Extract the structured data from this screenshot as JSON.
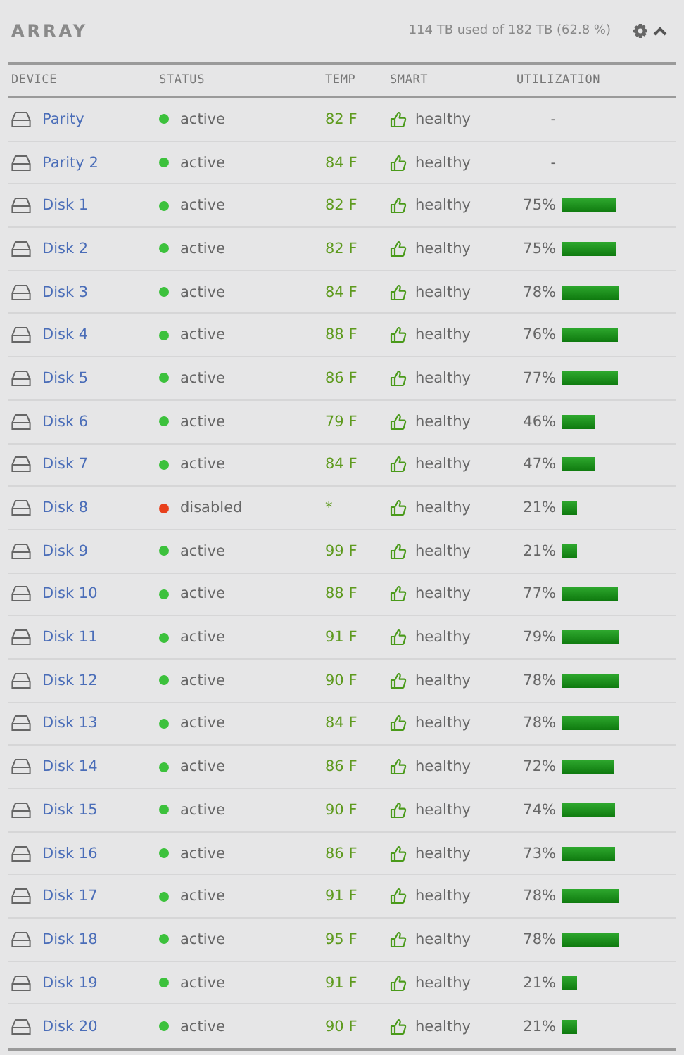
{
  "panel": {
    "title": "ARRAY",
    "usage": "114 TB used of 182 TB (62.8 %)"
  },
  "columns": [
    "DEVICE",
    "STATUS",
    "TEMP",
    "SMART",
    "UTILIZATION"
  ],
  "rows": [
    {
      "device": "Parity",
      "status": "active",
      "color": "#3cc13c",
      "temp": "82 F",
      "smart": "healthy",
      "utilization": "-"
    },
    {
      "device": "Parity 2",
      "status": "active",
      "color": "#3cc13c",
      "temp": "84 F",
      "smart": "healthy",
      "utilization": "-"
    },
    {
      "device": "Disk 1",
      "status": "active",
      "color": "#3cc13c",
      "temp": "82 F",
      "smart": "healthy",
      "utilization": "75%"
    },
    {
      "device": "Disk 2",
      "status": "active",
      "color": "#3cc13c",
      "temp": "82 F",
      "smart": "healthy",
      "utilization": "75%"
    },
    {
      "device": "Disk 3",
      "status": "active",
      "color": "#3cc13c",
      "temp": "84 F",
      "smart": "healthy",
      "utilization": "78%"
    },
    {
      "device": "Disk 4",
      "status": "active",
      "color": "#3cc13c",
      "temp": "88 F",
      "smart": "healthy",
      "utilization": "76%"
    },
    {
      "device": "Disk 5",
      "status": "active",
      "color": "#3cc13c",
      "temp": "86 F",
      "smart": "healthy",
      "utilization": "77%"
    },
    {
      "device": "Disk 6",
      "status": "active",
      "color": "#3cc13c",
      "temp": "79 F",
      "smart": "healthy",
      "utilization": "46%"
    },
    {
      "device": "Disk 7",
      "status": "active",
      "color": "#3cc13c",
      "temp": "84 F",
      "smart": "healthy",
      "utilization": "47%"
    },
    {
      "device": "Disk 8",
      "status": "disabled",
      "color": "#e8401c",
      "temp": "*",
      "smart": "healthy",
      "utilization": "21%"
    },
    {
      "device": "Disk 9",
      "status": "active",
      "color": "#3cc13c",
      "temp": "99 F",
      "smart": "healthy",
      "utilization": "21%"
    },
    {
      "device": "Disk 10",
      "status": "active",
      "color": "#3cc13c",
      "temp": "88 F",
      "smart": "healthy",
      "utilization": "77%"
    },
    {
      "device": "Disk 11",
      "status": "active",
      "color": "#3cc13c",
      "temp": "91 F",
      "smart": "healthy",
      "utilization": "79%"
    },
    {
      "device": "Disk 12",
      "status": "active",
      "color": "#3cc13c",
      "temp": "90 F",
      "smart": "healthy",
      "utilization": "78%"
    },
    {
      "device": "Disk 13",
      "status": "active",
      "color": "#3cc13c",
      "temp": "84 F",
      "smart": "healthy",
      "utilization": "78%"
    },
    {
      "device": "Disk 14",
      "status": "active",
      "color": "#3cc13c",
      "temp": "86 F",
      "smart": "healthy",
      "utilization": "72%"
    },
    {
      "device": "Disk 15",
      "status": "active",
      "color": "#3cc13c",
      "temp": "90 F",
      "smart": "healthy",
      "utilization": "74%"
    },
    {
      "device": "Disk 16",
      "status": "active",
      "color": "#3cc13c",
      "temp": "86 F",
      "smart": "healthy",
      "utilization": "73%"
    },
    {
      "device": "Disk 17",
      "status": "active",
      "color": "#3cc13c",
      "temp": "91 F",
      "smart": "healthy",
      "utilization": "78%"
    },
    {
      "device": "Disk 18",
      "status": "active",
      "color": "#3cc13c",
      "temp": "95 F",
      "smart": "healthy",
      "utilization": "78%"
    },
    {
      "device": "Disk 19",
      "status": "active",
      "color": "#3cc13c",
      "temp": "91 F",
      "smart": "healthy",
      "utilization": "21%"
    },
    {
      "device": "Disk 20",
      "status": "active",
      "color": "#3cc13c",
      "temp": "90 F",
      "smart": "healthy",
      "utilization": "21%"
    }
  ]
}
